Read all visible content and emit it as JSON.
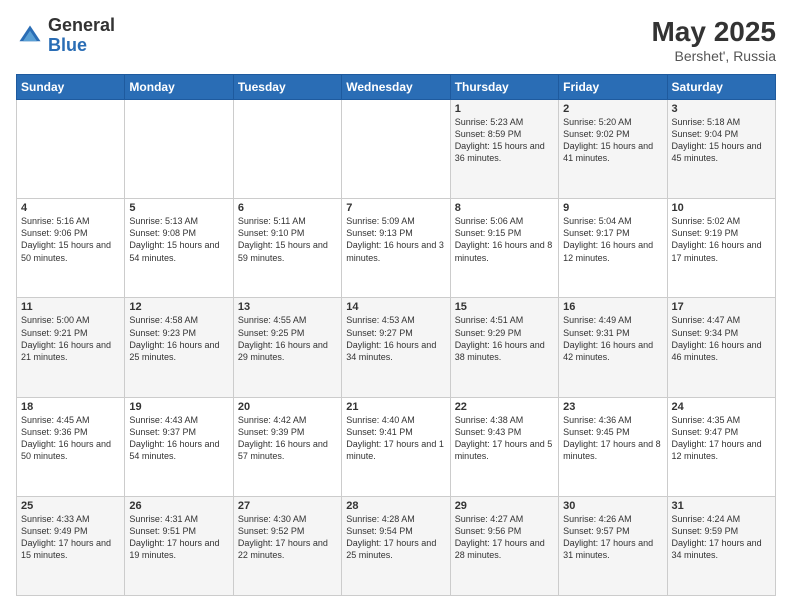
{
  "header": {
    "logo_general": "General",
    "logo_blue": "Blue",
    "title": "May 2025",
    "location": "Bershet', Russia"
  },
  "weekdays": [
    "Sunday",
    "Monday",
    "Tuesday",
    "Wednesday",
    "Thursday",
    "Friday",
    "Saturday"
  ],
  "weeks": [
    [
      {
        "day": "",
        "info": ""
      },
      {
        "day": "",
        "info": ""
      },
      {
        "day": "",
        "info": ""
      },
      {
        "day": "",
        "info": ""
      },
      {
        "day": "1",
        "info": "Sunrise: 5:23 AM\nSunset: 8:59 PM\nDaylight: 15 hours and 36 minutes."
      },
      {
        "day": "2",
        "info": "Sunrise: 5:20 AM\nSunset: 9:02 PM\nDaylight: 15 hours and 41 minutes."
      },
      {
        "day": "3",
        "info": "Sunrise: 5:18 AM\nSunset: 9:04 PM\nDaylight: 15 hours and 45 minutes."
      }
    ],
    [
      {
        "day": "4",
        "info": "Sunrise: 5:16 AM\nSunset: 9:06 PM\nDaylight: 15 hours and 50 minutes."
      },
      {
        "day": "5",
        "info": "Sunrise: 5:13 AM\nSunset: 9:08 PM\nDaylight: 15 hours and 54 minutes."
      },
      {
        "day": "6",
        "info": "Sunrise: 5:11 AM\nSunset: 9:10 PM\nDaylight: 15 hours and 59 minutes."
      },
      {
        "day": "7",
        "info": "Sunrise: 5:09 AM\nSunset: 9:13 PM\nDaylight: 16 hours and 3 minutes."
      },
      {
        "day": "8",
        "info": "Sunrise: 5:06 AM\nSunset: 9:15 PM\nDaylight: 16 hours and 8 minutes."
      },
      {
        "day": "9",
        "info": "Sunrise: 5:04 AM\nSunset: 9:17 PM\nDaylight: 16 hours and 12 minutes."
      },
      {
        "day": "10",
        "info": "Sunrise: 5:02 AM\nSunset: 9:19 PM\nDaylight: 16 hours and 17 minutes."
      }
    ],
    [
      {
        "day": "11",
        "info": "Sunrise: 5:00 AM\nSunset: 9:21 PM\nDaylight: 16 hours and 21 minutes."
      },
      {
        "day": "12",
        "info": "Sunrise: 4:58 AM\nSunset: 9:23 PM\nDaylight: 16 hours and 25 minutes."
      },
      {
        "day": "13",
        "info": "Sunrise: 4:55 AM\nSunset: 9:25 PM\nDaylight: 16 hours and 29 minutes."
      },
      {
        "day": "14",
        "info": "Sunrise: 4:53 AM\nSunset: 9:27 PM\nDaylight: 16 hours and 34 minutes."
      },
      {
        "day": "15",
        "info": "Sunrise: 4:51 AM\nSunset: 9:29 PM\nDaylight: 16 hours and 38 minutes."
      },
      {
        "day": "16",
        "info": "Sunrise: 4:49 AM\nSunset: 9:31 PM\nDaylight: 16 hours and 42 minutes."
      },
      {
        "day": "17",
        "info": "Sunrise: 4:47 AM\nSunset: 9:34 PM\nDaylight: 16 hours and 46 minutes."
      }
    ],
    [
      {
        "day": "18",
        "info": "Sunrise: 4:45 AM\nSunset: 9:36 PM\nDaylight: 16 hours and 50 minutes."
      },
      {
        "day": "19",
        "info": "Sunrise: 4:43 AM\nSunset: 9:37 PM\nDaylight: 16 hours and 54 minutes."
      },
      {
        "day": "20",
        "info": "Sunrise: 4:42 AM\nSunset: 9:39 PM\nDaylight: 16 hours and 57 minutes."
      },
      {
        "day": "21",
        "info": "Sunrise: 4:40 AM\nSunset: 9:41 PM\nDaylight: 17 hours and 1 minute."
      },
      {
        "day": "22",
        "info": "Sunrise: 4:38 AM\nSunset: 9:43 PM\nDaylight: 17 hours and 5 minutes."
      },
      {
        "day": "23",
        "info": "Sunrise: 4:36 AM\nSunset: 9:45 PM\nDaylight: 17 hours and 8 minutes."
      },
      {
        "day": "24",
        "info": "Sunrise: 4:35 AM\nSunset: 9:47 PM\nDaylight: 17 hours and 12 minutes."
      }
    ],
    [
      {
        "day": "25",
        "info": "Sunrise: 4:33 AM\nSunset: 9:49 PM\nDaylight: 17 hours and 15 minutes."
      },
      {
        "day": "26",
        "info": "Sunrise: 4:31 AM\nSunset: 9:51 PM\nDaylight: 17 hours and 19 minutes."
      },
      {
        "day": "27",
        "info": "Sunrise: 4:30 AM\nSunset: 9:52 PM\nDaylight: 17 hours and 22 minutes."
      },
      {
        "day": "28",
        "info": "Sunrise: 4:28 AM\nSunset: 9:54 PM\nDaylight: 17 hours and 25 minutes."
      },
      {
        "day": "29",
        "info": "Sunrise: 4:27 AM\nSunset: 9:56 PM\nDaylight: 17 hours and 28 minutes."
      },
      {
        "day": "30",
        "info": "Sunrise: 4:26 AM\nSunset: 9:57 PM\nDaylight: 17 hours and 31 minutes."
      },
      {
        "day": "31",
        "info": "Sunrise: 4:24 AM\nSunset: 9:59 PM\nDaylight: 17 hours and 34 minutes."
      }
    ]
  ]
}
